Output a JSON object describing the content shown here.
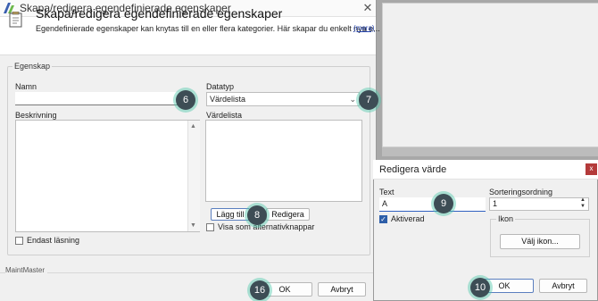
{
  "dialog": {
    "window_title": "Skapa/redigera egendefinierade egenskaper",
    "header_title": "Skapa/redigera egendefinierade egenskaper",
    "header_subtitle": "Egendefinierade egenskaper kan knytas till en eller flera kategorier. Här skapar du enkelt nya e...",
    "more_link": "(mera)",
    "group_title": "Egenskap",
    "name_label": "Namn",
    "name_value": "",
    "datatype_label": "Datatyp",
    "datatype_value": "Värdelista",
    "description_label": "Beskrivning",
    "valuelist_label": "Värdelista",
    "add_button": "Lägg till",
    "edit_button": "Redigera",
    "radio_checkbox_label": "Visa som alternativknappar",
    "readonly_label": "Endast läsning",
    "footer_brand": "MaintMaster",
    "ok_button": "OK",
    "cancel_button": "Avbryt"
  },
  "edit_dialog": {
    "title": "Redigera värde",
    "close_glyph": "x",
    "text_label": "Text",
    "text_value": "A",
    "sort_label": "Sorteringsordning",
    "sort_value": "1",
    "enabled_label": "Aktiverad",
    "enabled_checked": true,
    "icon_group_title": "Ikon",
    "choose_icon_button": "Välj ikon...",
    "ok_button": "OK",
    "cancel_button": "Avbryt"
  },
  "badges": [
    "6",
    "7",
    "8",
    "9",
    "10",
    "16"
  ],
  "colors": {
    "accent": "#2d5ea8",
    "badge": "#3d4d55",
    "badge_glow": "#50c8aa",
    "close_red": "#b43a3a"
  }
}
